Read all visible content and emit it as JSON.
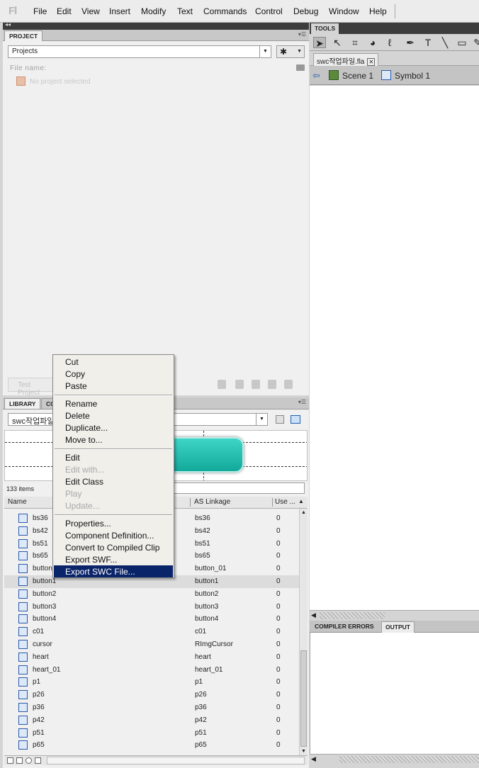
{
  "app": {
    "logo": "Fl"
  },
  "menubar": {
    "items": [
      "File",
      "Edit",
      "View",
      "Insert",
      "Modify",
      "Text",
      "Commands",
      "Control",
      "Debug",
      "Window",
      "Help"
    ]
  },
  "project_panel": {
    "tab": "PROJECT",
    "projects_select": "Projects",
    "file_name_label": "File name:",
    "no_project_text": "No project selected",
    "test_button": "Test Project"
  },
  "library_panel": {
    "tab": "LIBRARY",
    "tab2": "CO",
    "document_select": "swc작업파일.fla",
    "items_count": "133 items",
    "columns": {
      "name": "Name",
      "linkage": "AS Linkage",
      "use": "Use ..."
    },
    "rows": [
      {
        "name": "bs36",
        "linkage": "bs36",
        "use": "0"
      },
      {
        "name": "bs42",
        "linkage": "bs42",
        "use": "0"
      },
      {
        "name": "bs51",
        "linkage": "bs51",
        "use": "0"
      },
      {
        "name": "bs65",
        "linkage": "bs65",
        "use": "0"
      },
      {
        "name": "button_01",
        "linkage": "button_01",
        "use": "0"
      },
      {
        "name": "button1",
        "linkage": "button1",
        "use": "0"
      },
      {
        "name": "button2",
        "linkage": "button2",
        "use": "0"
      },
      {
        "name": "button3",
        "linkage": "button3",
        "use": "0"
      },
      {
        "name": "button4",
        "linkage": "button4",
        "use": "0"
      },
      {
        "name": "c01",
        "linkage": "c01",
        "use": "0"
      },
      {
        "name": "cursor",
        "linkage": "RImgCursor",
        "use": "0"
      },
      {
        "name": "heart",
        "linkage": "heart",
        "use": "0"
      },
      {
        "name": "heart_01",
        "linkage": "heart_01",
        "use": "0"
      },
      {
        "name": "p1",
        "linkage": "p1",
        "use": "0"
      },
      {
        "name": "p26",
        "linkage": "p26",
        "use": "0"
      },
      {
        "name": "p36",
        "linkage": "p36",
        "use": "0"
      },
      {
        "name": "p42",
        "linkage": "p42",
        "use": "0"
      },
      {
        "name": "p51",
        "linkage": "p51",
        "use": "0"
      },
      {
        "name": "p65",
        "linkage": "p65",
        "use": "0"
      }
    ],
    "selected_row": "button1"
  },
  "context_menu": {
    "groups": [
      [
        "Cut",
        "Copy",
        "Paste"
      ],
      [
        "Rename",
        "Delete",
        "Duplicate...",
        "Move to..."
      ],
      [
        "Edit",
        "Edit with...",
        "Edit Class",
        "Play",
        "Update..."
      ],
      [
        "Properties...",
        "Component Definition...",
        "Convert to Compiled Clip",
        "Export SWF...",
        "Export SWC File..."
      ]
    ],
    "disabled": [
      "Edit with...",
      "Play",
      "Update..."
    ],
    "highlighted": "Export SWC File...",
    "highlight_color": "#0a246a"
  },
  "tools_panel": {
    "tab": "TOOLS"
  },
  "document": {
    "tab": "swc작업파일.fla",
    "breadcrumb": [
      "Scene 1",
      "Symbol 1"
    ]
  },
  "output_panel": {
    "tabs": [
      "COMPILER ERRORS",
      "OUTPUT"
    ],
    "active_tab": "OUTPUT"
  }
}
